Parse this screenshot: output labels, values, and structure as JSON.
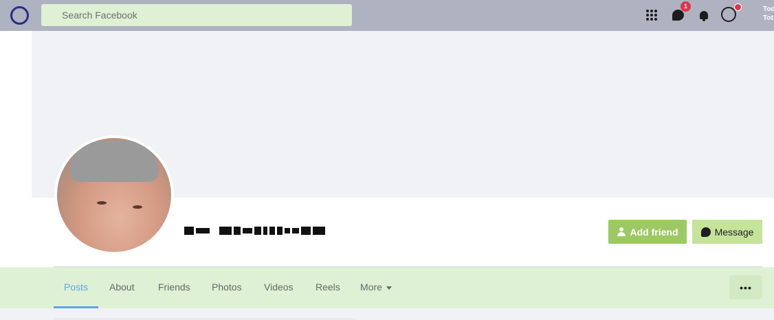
{
  "topbar": {
    "search_placeholder": "Search Facebook",
    "messenger_badge": "1",
    "user_text_line1": "Tod",
    "user_text_line2": "Tot"
  },
  "actions": {
    "add_friend": "Add friend",
    "message": "Message"
  },
  "tabs": [
    {
      "label": "Posts"
    },
    {
      "label": "About"
    },
    {
      "label": "Friends"
    },
    {
      "label": "Photos"
    },
    {
      "label": "Videos"
    },
    {
      "label": "Reels"
    },
    {
      "label": "More"
    }
  ],
  "more_menu_label": "•••",
  "colors": {
    "topbar": "#aeb2c1",
    "search_bg": "#dff1d5",
    "add_friend_bg": "#9cc962",
    "message_bg": "#c6e39a",
    "tab_active": "#5ea4e8",
    "tabs_bar": "#dff1d5"
  }
}
